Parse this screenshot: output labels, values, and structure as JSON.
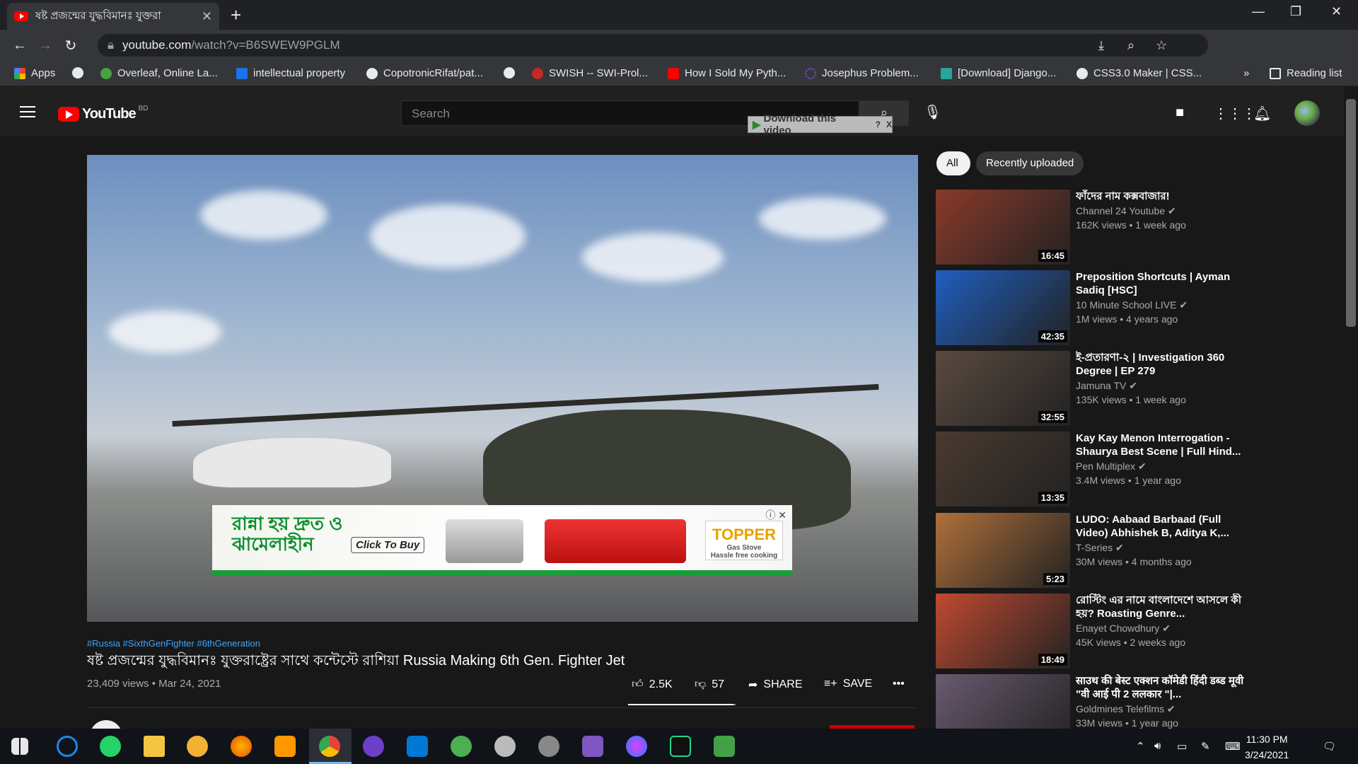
{
  "browser": {
    "tab_title": "ষষ্ট প্রজন্মের যুদ্ধবিমানঃ যুক্তরা",
    "url_host": "youtube.com",
    "url_path": "/watch?v=B6SWEW9PGLM",
    "bookmarks": [
      {
        "label": "Apps",
        "color": "#4285f4"
      },
      {
        "label": "",
        "color": "#e8eaed"
      },
      {
        "label": "Overleaf, Online La...",
        "color": "#47a141"
      },
      {
        "label": "intellectual property",
        "color": "#1a73e8"
      },
      {
        "label": "CopotronicRifat/pat...",
        "color": "#e8eaed"
      },
      {
        "label": "",
        "color": "#e8eaed"
      },
      {
        "label": "SWISH -- SWI-Prol...",
        "color": "#c62828"
      },
      {
        "label": "How I Sold My Pyth...",
        "color": "#ff0000"
      },
      {
        "label": "Josephus Problem...",
        "color": "#7c4dff"
      },
      {
        "label": "[Download] Django...",
        "color": "#26a69a"
      },
      {
        "label": "CSS3.0 Maker | CSS...",
        "color": "#e8eaed"
      }
    ],
    "reading_list": "Reading list",
    "overflow": "»"
  },
  "youtube": {
    "logo_text": "YouTube",
    "region": "BD",
    "search_placeholder": "Search",
    "download_label": "Download this video",
    "download_help": "?",
    "download_close": "X"
  },
  "video": {
    "tags": "#Russia #SixthGenFighter #6thGeneration",
    "title": "ষষ্ট প্রজন্মের যুদ্ধবিমানঃ যুক্তরাষ্ট্রের সাথে কন্টেস্টে রাশিয়া Russia Making 6th Gen. Fighter Jet",
    "views_date": "23,409 views • Mar 24, 2021",
    "likes": "2.5K",
    "dislikes": "57",
    "share": "SHARE",
    "save": "SAVE",
    "like_ratio": 0.98
  },
  "ad": {
    "headline": "রান্না হয় দ্রুত ও ঝামেলাহীন",
    "cta": "Click To Buy",
    "brand": "TOPPER",
    "brand_sub": "Gas Stove",
    "brand_tag": "Hassle free cooking"
  },
  "chips": [
    "All",
    "Recently uploaded"
  ],
  "recommendations": [
    {
      "title": "ফাঁদের নাম কক্সবাজার!",
      "channel": "Channel 24 Youtube",
      "meta": "162K views • 1 week ago",
      "duration": "16:45",
      "color": "#8a3a2a"
    },
    {
      "title": "Preposition Shortcuts | Ayman Sadiq [HSC]",
      "channel": "10 Minute School LIVE",
      "meta": "1M views • 4 years ago",
      "duration": "42:35",
      "color": "#1f5fbf"
    },
    {
      "title": "ই-প্রতারণা-২ | Investigation 360 Degree | EP 279",
      "channel": "Jamuna TV",
      "meta": "135K views • 1 week ago",
      "duration": "32:55",
      "color": "#5a4a40"
    },
    {
      "title": "Kay Kay Menon Interrogation - Shaurya Best Scene | Full Hind...",
      "channel": "Pen Multiplex",
      "meta": "3.4M views • 1 year ago",
      "duration": "13:35",
      "color": "#4a3a30"
    },
    {
      "title": "LUDO: Aabaad Barbaad (Full Video) Abhishek B, Aditya K,...",
      "channel": "T-Series",
      "meta": "30M views • 4 months ago",
      "duration": "5:23",
      "color": "#b0703a"
    },
    {
      "title": "রোস্টিং এর নামে বাংলাদেশে আসলে কী হয়? Roasting Genre...",
      "channel": "Enayet Chowdhury",
      "meta": "45K views • 2 weeks ago",
      "duration": "18:49",
      "color": "#c04a30"
    },
    {
      "title": "साउथ की बेस्ट एक्शन कॉमेडी हिंदी डब्ड मूवी \"वी आई पी 2 ललकार \"|...",
      "channel": "Goldmines Telefilms",
      "meta": "33M views • 1 year ago",
      "duration": "",
      "color": "#6a5a70"
    }
  ],
  "taskbar": {
    "time": "11:30 PM",
    "date": "3/24/2021"
  }
}
